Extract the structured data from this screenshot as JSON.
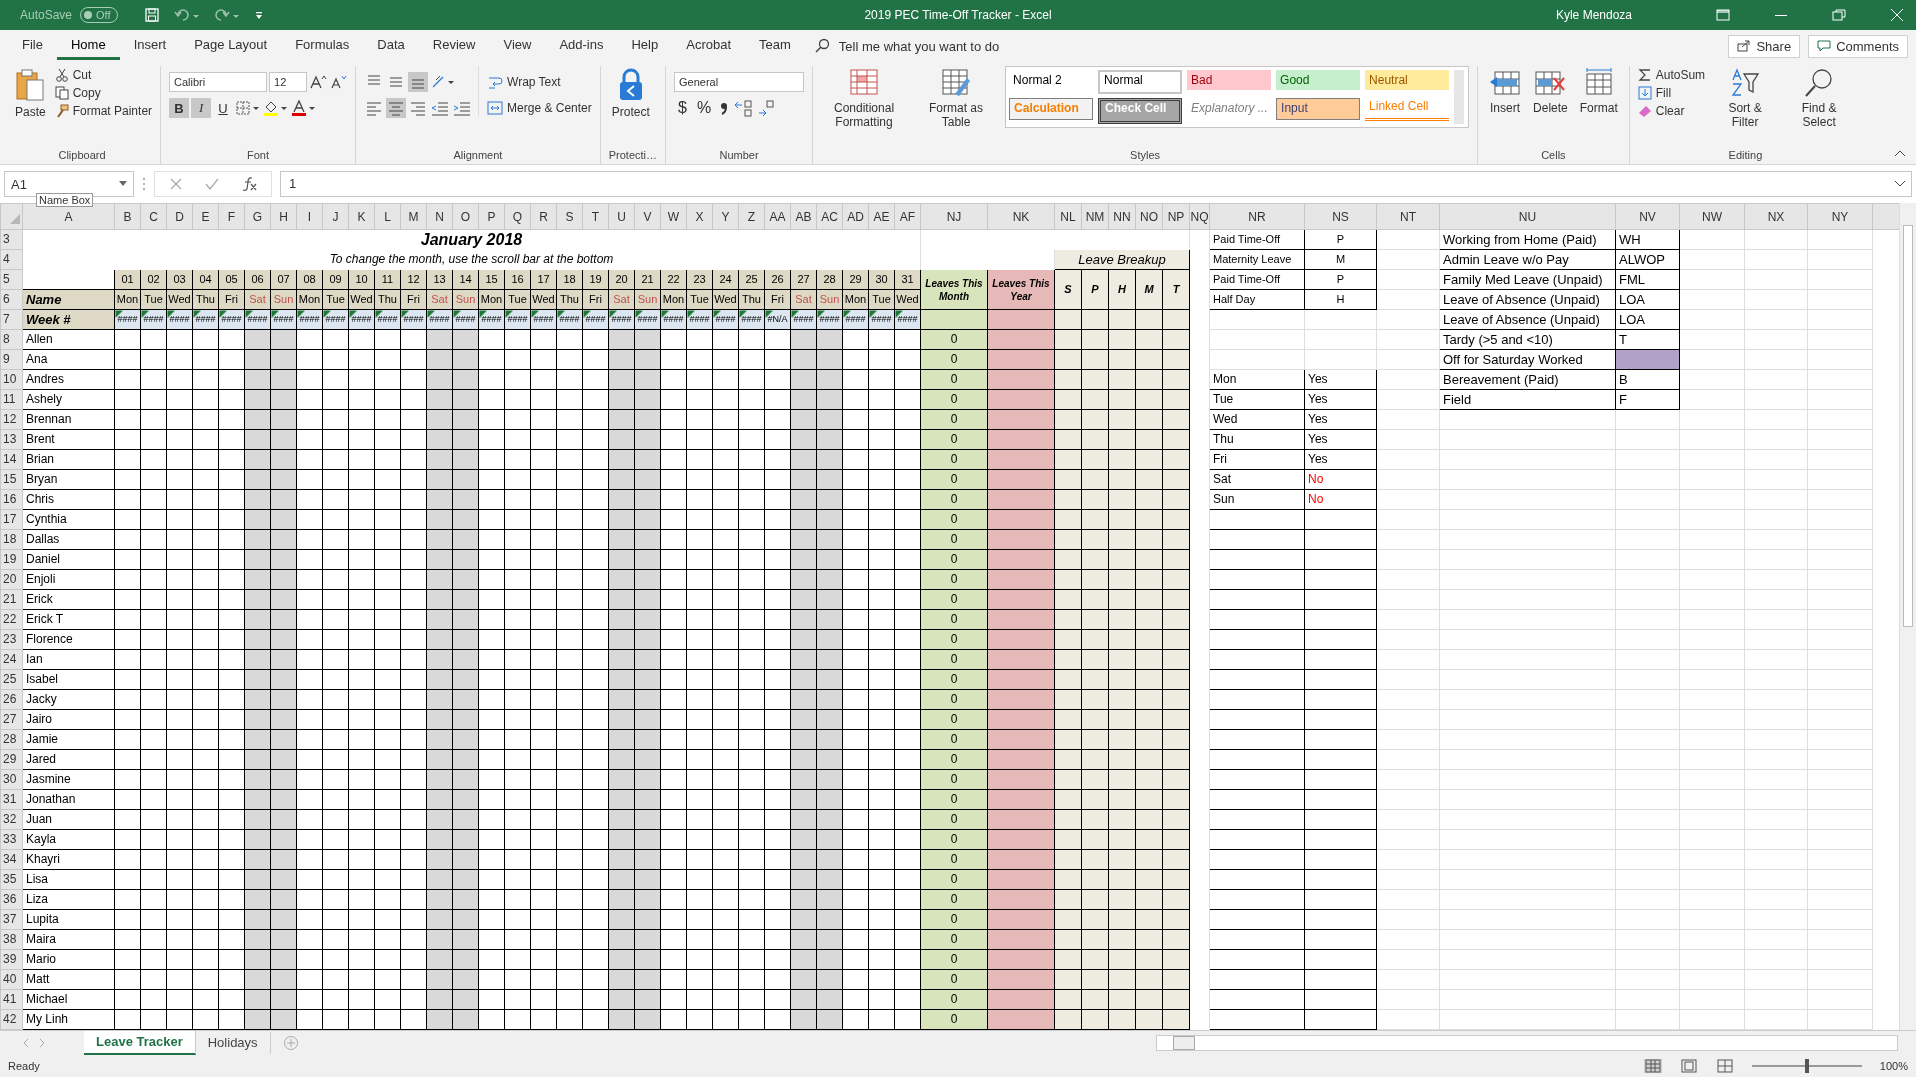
{
  "title_bar": {
    "autosave": "AutoSave",
    "autosave_state": "Off",
    "autosave_on": false,
    "title": "2019 PEC Time-Off Tracker  -  Excel",
    "user": "Kyle Mendoza"
  },
  "ribbon_tabs": [
    {
      "label": "File",
      "selected": false
    },
    {
      "label": "Home",
      "selected": true
    },
    {
      "label": "Insert",
      "selected": false
    },
    {
      "label": "Page Layout",
      "selected": false
    },
    {
      "label": "Formulas",
      "selected": false
    },
    {
      "label": "Data",
      "selected": false
    },
    {
      "label": "Review",
      "selected": false
    },
    {
      "label": "View",
      "selected": false
    },
    {
      "label": "Add-ins",
      "selected": false
    },
    {
      "label": "Help",
      "selected": false
    },
    {
      "label": "Acrobat",
      "selected": false
    },
    {
      "label": "Team",
      "selected": false
    }
  ],
  "tell_me": "Tell me what you want to do",
  "share": "Share",
  "comments": "Comments",
  "clipboard": {
    "label": "Clipboard",
    "paste": "Paste",
    "cut": "Cut",
    "copy": "Copy",
    "format_painter": "Format Painter"
  },
  "font": {
    "label": "Font",
    "name": "Calibri",
    "size": "12",
    "bold": {
      "text": "B",
      "pressed": true
    },
    "italic": {
      "text": "I",
      "pressed": true
    },
    "underline": {
      "text": "U",
      "pressed": false
    }
  },
  "alignment": {
    "label": "Alignment",
    "wrap_text": "Wrap Text",
    "merge_center": "Merge & Center",
    "vertical": [
      {
        "selected": false
      },
      {
        "selected": false
      },
      {
        "selected": true
      }
    ],
    "horizontal": [
      {
        "selected": false
      },
      {
        "selected": true
      },
      {
        "selected": false
      }
    ]
  },
  "protection": {
    "label": "Protecti…",
    "protect": "Protect"
  },
  "number": {
    "label": "Number",
    "format": "General",
    "currency": "$",
    "percent": "%"
  },
  "styles": {
    "label": "Styles",
    "conditional": "Conditional Formatting",
    "format_table": "Format as Table",
    "gallery": [
      {
        "text": "Normal 2",
        "kind": "plain"
      },
      {
        "text": "Normal",
        "kind": "normal"
      },
      {
        "text": "Bad",
        "kind": "bad"
      },
      {
        "text": "Good",
        "kind": "good"
      },
      {
        "text": "Neutral",
        "kind": "neutral"
      },
      {
        "text": "Calculation",
        "kind": "calculation"
      },
      {
        "text": "Check Cell",
        "kind": "check"
      },
      {
        "text": "Explanatory ...",
        "kind": "explanatory"
      },
      {
        "text": "Input",
        "kind": "input"
      },
      {
        "text": "Linked Cell",
        "kind": "linked"
      }
    ]
  },
  "cells": {
    "label": "Cells",
    "insert": "Insert",
    "delete": "Delete",
    "format": "Format"
  },
  "editing": {
    "label": "Editing",
    "autosum": "AutoSum",
    "fill": "Fill",
    "clear": "Clear",
    "sort": "Sort & Filter",
    "find": "Find & Select"
  },
  "formula_bar": {
    "name_box": "A1",
    "tooltip": "Name Box",
    "formula": "1"
  },
  "sheet": {
    "columns": [
      "A",
      "B",
      "C",
      "D",
      "E",
      "F",
      "G",
      "H",
      "I",
      "J",
      "K",
      "L",
      "M",
      "N",
      "O",
      "P",
      "Q",
      "R",
      "S",
      "T",
      "U",
      "V",
      "W",
      "X",
      "Y",
      "Z",
      "AA",
      "AB",
      "AC",
      "AD",
      "AE",
      "AF",
      "NJ",
      "NK",
      "NL",
      "NM",
      "NN",
      "NO",
      "NP",
      "NQ",
      "NR",
      "NS",
      "NT",
      "NU",
      "NV",
      "NW",
      "NX",
      "NY"
    ],
    "row_numbers": [
      "3",
      "4",
      "5",
      "6",
      "7",
      "8",
      "9",
      "10",
      "11",
      "12",
      "13",
      "14",
      "15",
      "16",
      "17",
      "18",
      "19",
      "20",
      "21",
      "22",
      "23",
      "24",
      "25",
      "26",
      "27",
      "28",
      "29",
      "30",
      "31",
      "32",
      "33",
      "34",
      "35",
      "36",
      "37",
      "38",
      "39",
      "40",
      "41",
      "42"
    ],
    "title": "January 2018",
    "subtitle": "To change the month, use the scroll bar at the bottom",
    "name_header": "Name",
    "week_header": "Week #",
    "days": [
      {
        "date": "01",
        "weekday": "Mon",
        "weekend": false,
        "week": "####"
      },
      {
        "date": "02",
        "weekday": "Tue",
        "weekend": false,
        "week": "####"
      },
      {
        "date": "03",
        "weekday": "Wed",
        "weekend": false,
        "week": "####"
      },
      {
        "date": "04",
        "weekday": "Thu",
        "weekend": false,
        "week": "####"
      },
      {
        "date": "05",
        "weekday": "Fri",
        "weekend": false,
        "week": "####"
      },
      {
        "date": "06",
        "weekday": "Sat",
        "weekend": true,
        "week": "####"
      },
      {
        "date": "07",
        "weekday": "Sun",
        "weekend": true,
        "week": "####"
      },
      {
        "date": "08",
        "weekday": "Mon",
        "weekend": false,
        "week": "####"
      },
      {
        "date": "09",
        "weekday": "Tue",
        "weekend": false,
        "week": "####"
      },
      {
        "date": "10",
        "weekday": "Wed",
        "weekend": false,
        "week": "####"
      },
      {
        "date": "11",
        "weekday": "Thu",
        "weekend": false,
        "week": "####"
      },
      {
        "date": "12",
        "weekday": "Fri",
        "weekend": false,
        "week": "####"
      },
      {
        "date": "13",
        "weekday": "Sat",
        "weekend": true,
        "week": "####"
      },
      {
        "date": "14",
        "weekday": "Sun",
        "weekend": true,
        "week": "####"
      },
      {
        "date": "15",
        "weekday": "Mon",
        "weekend": false,
        "week": "####"
      },
      {
        "date": "16",
        "weekday": "Tue",
        "weekend": false,
        "week": "####"
      },
      {
        "date": "17",
        "weekday": "Wed",
        "weekend": false,
        "week": "####"
      },
      {
        "date": "18",
        "weekday": "Thu",
        "weekend": false,
        "week": "####"
      },
      {
        "date": "19",
        "weekday": "Fri",
        "weekend": false,
        "week": "####"
      },
      {
        "date": "20",
        "weekday": "Sat",
        "weekend": true,
        "week": "####"
      },
      {
        "date": "21",
        "weekday": "Sun",
        "weekend": true,
        "week": "####"
      },
      {
        "date": "22",
        "weekday": "Mon",
        "weekend": false,
        "week": "####"
      },
      {
        "date": "23",
        "weekday": "Tue",
        "weekend": false,
        "week": "####"
      },
      {
        "date": "24",
        "weekday": "Wed",
        "weekend": false,
        "week": "####"
      },
      {
        "date": "25",
        "weekday": "Thu",
        "weekend": false,
        "week": "####"
      },
      {
        "date": "26",
        "weekday": "Fri",
        "weekend": false,
        "week": "#N/A"
      },
      {
        "date": "27",
        "weekday": "Sat",
        "weekend": true,
        "week": "####"
      },
      {
        "date": "28",
        "weekday": "Sun",
        "weekend": true,
        "week": "####"
      },
      {
        "date": "29",
        "weekday": "Mon",
        "weekend": false,
        "week": "####"
      },
      {
        "date": "30",
        "weekday": "Tue",
        "weekend": false,
        "week": "####"
      },
      {
        "date": "31",
        "weekday": "Wed",
        "weekend": false,
        "week": "####"
      }
    ],
    "month_header": "Leaves This Month",
    "year_header": "Leaves This Year",
    "breakup": {
      "title": "Leave Breakup",
      "letters": [
        "S",
        "P",
        "H",
        "M",
        "T"
      ]
    },
    "employees": [
      {
        "name": "Allen",
        "leaves_month": "0"
      },
      {
        "name": "Ana",
        "leaves_month": "0"
      },
      {
        "name": "Andres",
        "leaves_month": "0"
      },
      {
        "name": "Ashely",
        "leaves_month": "0"
      },
      {
        "name": "Brennan",
        "leaves_month": "0"
      },
      {
        "name": "Brent",
        "leaves_month": "0"
      },
      {
        "name": "Brian",
        "leaves_month": "0"
      },
      {
        "name": "Bryan",
        "leaves_month": "0"
      },
      {
        "name": "Chris",
        "leaves_month": "0"
      },
      {
        "name": "Cynthia",
        "leaves_month": "0"
      },
      {
        "name": "Dallas",
        "leaves_month": "0"
      },
      {
        "name": "Daniel",
        "leaves_month": "0"
      },
      {
        "name": "Enjoli",
        "leaves_month": "0"
      },
      {
        "name": "Erick",
        "leaves_month": "0"
      },
      {
        "name": "Erick T",
        "leaves_month": "0"
      },
      {
        "name": "Florence",
        "leaves_month": "0"
      },
      {
        "name": "Ian",
        "leaves_month": "0"
      },
      {
        "name": "Isabel",
        "leaves_month": "0"
      },
      {
        "name": "Jacky",
        "leaves_month": "0"
      },
      {
        "name": "Jairo",
        "leaves_month": "0"
      },
      {
        "name": "Jamie",
        "leaves_month": "0"
      },
      {
        "name": "Jared",
        "leaves_month": "0"
      },
      {
        "name": "Jasmine",
        "leaves_month": "0"
      },
      {
        "name": "Jonathan",
        "leaves_month": "0"
      },
      {
        "name": "Juan",
        "leaves_month": "0"
      },
      {
        "name": "Kayla",
        "leaves_month": "0"
      },
      {
        "name": "Khayri",
        "leaves_month": "0"
      },
      {
        "name": "Lisa",
        "leaves_month": "0"
      },
      {
        "name": "Liza",
        "leaves_month": "0"
      },
      {
        "name": "Lupita",
        "leaves_month": "0"
      },
      {
        "name": "Maira",
        "leaves_month": "0"
      },
      {
        "name": "Mario",
        "leaves_month": "0"
      },
      {
        "name": "Matt",
        "leaves_month": "0"
      },
      {
        "name": "Michael",
        "leaves_month": "0"
      },
      {
        "name": "My Linh",
        "leaves_month": "0"
      }
    ],
    "leave_codes": [
      {
        "label": "Paid Time-Off",
        "code": "P"
      },
      {
        "label": "Maternity Leave",
        "code": "M"
      },
      {
        "label": "Paid Time-Off",
        "code": "P"
      },
      {
        "label": "Half Day",
        "code": "H"
      }
    ],
    "workdays": [
      {
        "day": "Mon",
        "value": "Yes",
        "working": true
      },
      {
        "day": "Tue",
        "value": "Yes",
        "working": true
      },
      {
        "day": "Wed",
        "value": "Yes",
        "working": true
      },
      {
        "day": "Thu",
        "value": "Yes",
        "working": true
      },
      {
        "day": "Fri",
        "value": "Yes",
        "working": true
      },
      {
        "day": "Sat",
        "value": "No",
        "working": false
      },
      {
        "day": "Sun",
        "value": "No",
        "working": false
      }
    ],
    "leave_types": [
      {
        "label": "Working from Home (Paid)",
        "code": "WH"
      },
      {
        "label": "Admin Leave w/o Pay",
        "code": "ALWOP"
      },
      {
        "label": "Family Med Leave (Unpaid)",
        "code": "FML"
      },
      {
        "label": "Leave of Absence (Unpaid)",
        "code": "LOA"
      },
      {
        "label": "Leave of Absence (Unpaid)",
        "code": "LOA"
      },
      {
        "label": "Tardy (>5 and <10)",
        "code": "T"
      },
      {
        "label": "Off for Saturday Worked",
        "color": "#b1a0c7"
      },
      {
        "label": "Bereavement (Paid)",
        "code": "B"
      },
      {
        "label": "Field",
        "code": "F"
      }
    ]
  },
  "sheet_tabs": [
    {
      "label": "Leave Tracker",
      "selected": true
    },
    {
      "label": "Holidays",
      "selected": false
    }
  ],
  "status_bar": {
    "status": "Ready",
    "zoom_level": {
      "level": 0.5
    },
    "zoom": "100%"
  }
}
